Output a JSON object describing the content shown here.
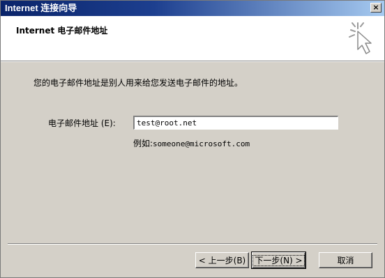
{
  "window": {
    "title": "Internet 连接向导",
    "close_label": "×"
  },
  "header": {
    "title": "Internet 电子邮件地址",
    "icon": "wizard-sparkle-cursor-icon"
  },
  "body": {
    "instruction": "您的电子邮件地址是别人用来给您发送电子邮件的地址。",
    "email_label": "电子邮件地址 (E):",
    "email_value": "test@root.net",
    "example_prefix": "例如:",
    "example_value": "someone@microsoft.com"
  },
  "buttons": {
    "back_label": "< 上一步(B)",
    "next_label": "下一步(N) >",
    "cancel_label": "取消"
  }
}
